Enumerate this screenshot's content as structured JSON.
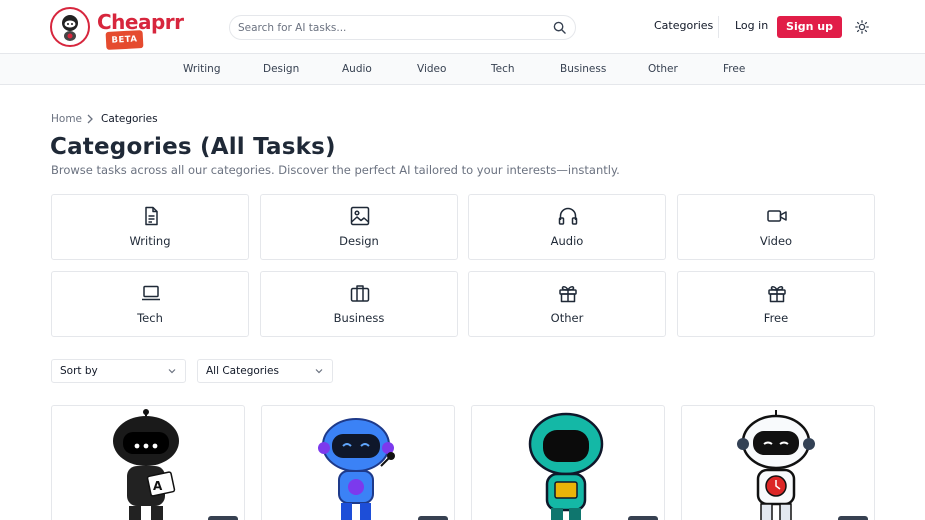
{
  "header": {
    "brand": "Cheaprr",
    "badge": "BETA",
    "search_placeholder": "Search for AI tasks...",
    "nav_categories": "Categories",
    "login": "Log in",
    "signup": "Sign up"
  },
  "subnav": [
    "Writing",
    "Design",
    "Audio",
    "Video",
    "Tech",
    "Business",
    "Other",
    "Free"
  ],
  "breadcrumb": {
    "home": "Home",
    "current": "Categories"
  },
  "page": {
    "title": "Categories (All Tasks)",
    "subtitle": "Browse tasks across all our categories. Discover the perfect AI tailored to your interests—instantly."
  },
  "categories": [
    {
      "label": "Writing",
      "icon": "document-icon"
    },
    {
      "label": "Design",
      "icon": "image-icon"
    },
    {
      "label": "Audio",
      "icon": "headphones-icon"
    },
    {
      "label": "Video",
      "icon": "video-camera-icon"
    },
    {
      "label": "Tech",
      "icon": "laptop-icon"
    },
    {
      "label": "Business",
      "icon": "briefcase-icon"
    },
    {
      "label": "Other",
      "icon": "gift-icon"
    },
    {
      "label": "Free",
      "icon": "gift-icon"
    }
  ],
  "filters": {
    "sort": "Sort by",
    "category": "All Categories"
  },
  "colors": {
    "brand": "#d7263d",
    "signup": "#e11d48",
    "beta": "#e54b2f"
  }
}
